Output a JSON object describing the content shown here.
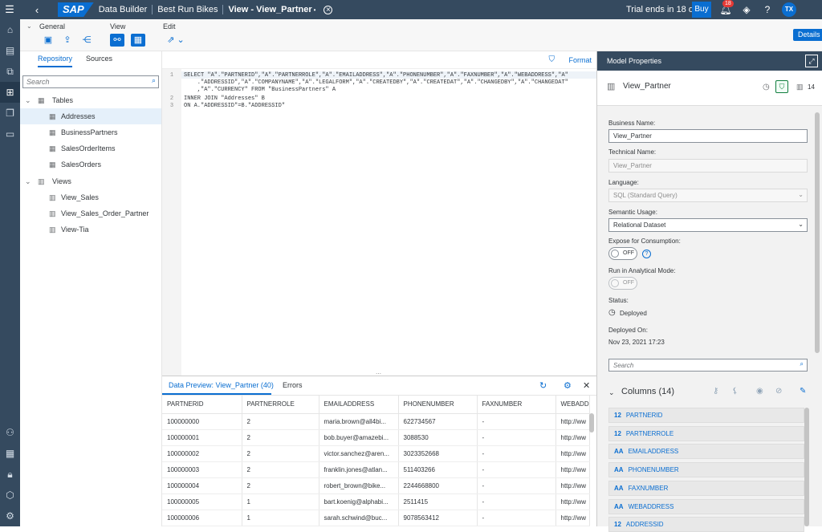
{
  "shell": {
    "logo": "SAP",
    "breadcrumbs": [
      "Data Builder",
      "Best Run Bikes",
      "View - View_Partner"
    ],
    "trial": "Trial ends in 18 days",
    "buy": "Buy",
    "notifications": "18",
    "avatar": "TX"
  },
  "toolbar": {
    "groups": [
      "General",
      "View",
      "Edit"
    ],
    "details": "Details"
  },
  "repository": {
    "tabs": [
      "Repository",
      "Sources"
    ],
    "search_placeholder": "Search",
    "tables_label": "Tables",
    "tables": [
      "Addresses",
      "BusinessPartners",
      "SalesOrderItems",
      "SalesOrders"
    ],
    "views_label": "Views",
    "views": [
      "View_Sales",
      "View_Sales_Order_Partner",
      "View-Tia"
    ]
  },
  "editor": {
    "format": "Format",
    "line_numbers": [
      "1",
      "2",
      "3"
    ],
    "lines": [
      "SELECT \"A\".\"PARTNERID\",\"A\".\"PARTNERROLE\",\"A\".\"EMAILADDRESS\",\"A\".\"PHONENUMBER\",\"A\".\"FAXNUMBER\",\"A\".\"WEBADDRESS\",\"A\"",
      "    .\"ADDRESSID\",\"A\".\"COMPANYNAME\",\"A\".\"LEGALFORM\",\"A\".\"CREATEDBY\",\"A\".\"CREATEDAT\",\"A\".\"CHANGEDBY\",\"A\".\"CHANGEDAT\"",
      "    ,\"A\".\"CURRENCY\" FROM \"BusinessPartners\" A",
      "INNER JOIN \"Addresses\" B",
      "ON A.\"ADDRESSID\"=B.\"ADDRESSID\""
    ]
  },
  "preview": {
    "tabs": [
      "Data Preview: View_Partner (40)",
      "Errors"
    ],
    "columns": [
      "PARTNERID",
      "PARTNERROLE",
      "EMAILADDRESS",
      "PHONENUMBER",
      "FAXNUMBER",
      "WEBADD"
    ],
    "rows": [
      [
        "100000000",
        "2",
        "maria.brown@all4bi...",
        "622734567",
        "-",
        "http://ww"
      ],
      [
        "100000001",
        "2",
        "bob.buyer@amazebi...",
        "3088530",
        "-",
        "http://ww"
      ],
      [
        "100000002",
        "2",
        "victor.sanchez@aren...",
        "3023352668",
        "-",
        "http://ww"
      ],
      [
        "100000003",
        "2",
        "franklin.jones@atlan...",
        "511403266",
        "-",
        "http://ww"
      ],
      [
        "100000004",
        "2",
        "robert_brown@bike...",
        "2244668800",
        "-",
        "http://ww"
      ],
      [
        "100000005",
        "1",
        "bart.koenig@alphabi...",
        "2511415",
        "-",
        "http://ww"
      ],
      [
        "100000006",
        "1",
        "sarah.schwind@buc...",
        "9078563412",
        "-",
        "http://ww"
      ]
    ]
  },
  "model_properties": {
    "header": "Model Properties",
    "object_name": "View_Partner",
    "object_count": "14",
    "business_name_label": "Business Name:",
    "business_name": "View_Partner",
    "technical_name_label": "Technical Name:",
    "technical_name": "View_Partner",
    "language_label": "Language:",
    "language": "SQL (Standard Query)",
    "semantic_label": "Semantic Usage:",
    "semantic": "Relational Dataset",
    "expose_label": "Expose for Consumption:",
    "expose_value": "OFF",
    "analytical_label": "Run in Analytical Mode:",
    "analytical_value": "OFF",
    "status_label": "Status:",
    "status": "Deployed",
    "deployed_label": "Deployed On:",
    "deployed_on": "Nov 23, 2021 17:23",
    "search_placeholder": "Search",
    "columns_header": "Columns (14)",
    "columns": [
      {
        "type": "12",
        "name": "PARTNERID"
      },
      {
        "type": "12",
        "name": "PARTNERROLE"
      },
      {
        "type": "AA",
        "name": "EMAILADDRESS"
      },
      {
        "type": "AA",
        "name": "PHONENUMBER"
      },
      {
        "type": "AA",
        "name": "FAXNUMBER"
      },
      {
        "type": "AA",
        "name": "WEBADDRESS"
      },
      {
        "type": "12",
        "name": "ADDRESSID"
      }
    ]
  }
}
